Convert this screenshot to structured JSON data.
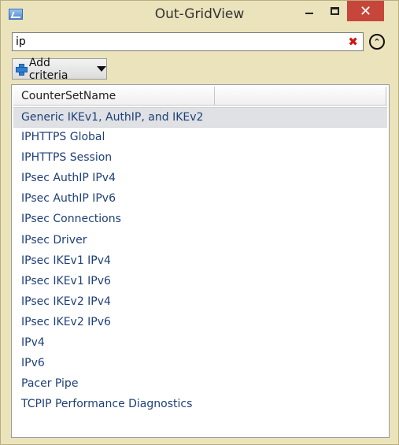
{
  "window": {
    "title": "Out-GridView",
    "minimize_glyph": "minimize-icon",
    "maximize_glyph": "maximize-icon",
    "close_glyph": "✕"
  },
  "filter": {
    "value": "ip",
    "clear_icon": "✖",
    "collapse_icon": "⌃"
  },
  "toolbar": {
    "add_criteria_label": "Add criteria"
  },
  "grid": {
    "columns": [
      "CounterSetName",
      ""
    ],
    "selected_index": 0,
    "rows": [
      "Generic IKEv1, AuthIP, and IKEv2",
      "IPHTTPS Global",
      "IPHTTPS Session",
      "IPsec AuthIP IPv4",
      "IPsec AuthIP IPv6",
      "IPsec Connections",
      "IPsec Driver",
      "IPsec IKEv1 IPv4",
      "IPsec IKEv1 IPv6",
      "IPsec IKEv2 IPv4",
      "IPsec IKEv2 IPv6",
      "IPv4",
      "IPv6",
      "Pacer Pipe",
      "TCPIP Performance Diagnostics"
    ]
  },
  "colors": {
    "chrome": "#ebe3bc",
    "close_button": "#c7463b",
    "row_text": "#1e3f78",
    "clear_icon": "#d01616"
  }
}
